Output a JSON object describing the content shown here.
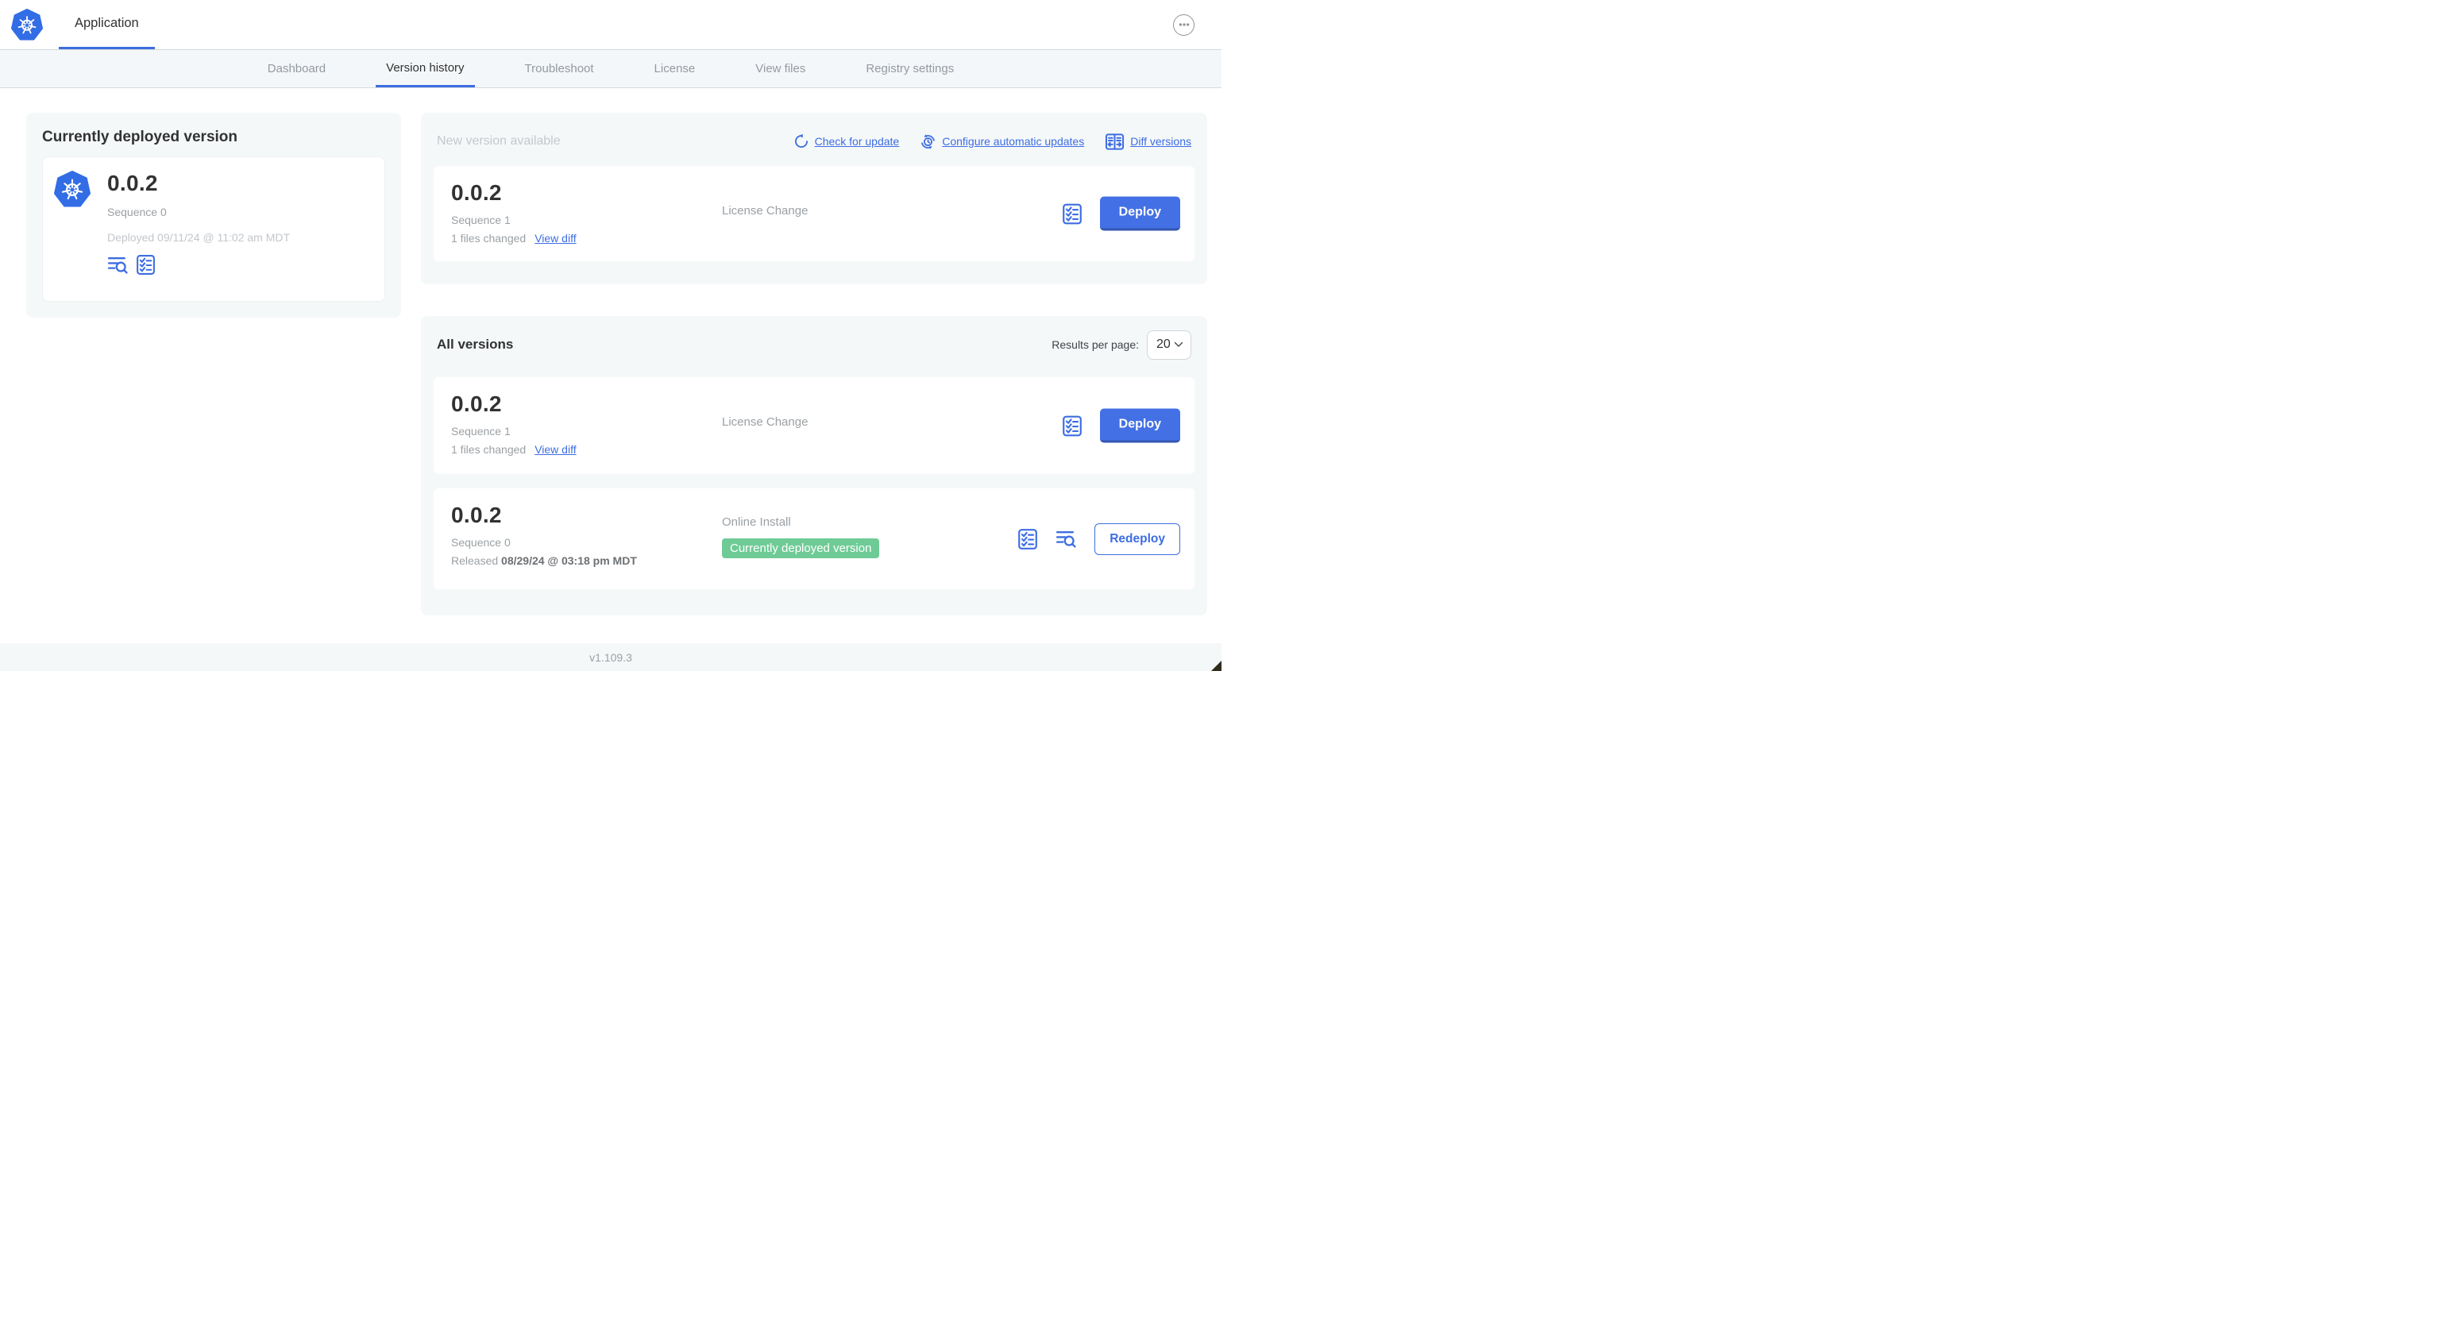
{
  "colors": {
    "accent_blue": "#3d6de2",
    "logo_blue": "#326de6",
    "deploy_button_blue": "#4370e4",
    "badge_green": "#6fcb96",
    "panel_gray": "#f5f8f9"
  },
  "header": {
    "app_tab": "Application"
  },
  "nav": {
    "tabs": [
      {
        "label": "Dashboard"
      },
      {
        "label": "Version history"
      },
      {
        "label": "Troubleshoot"
      },
      {
        "label": "License"
      },
      {
        "label": "View files"
      },
      {
        "label": "Registry settings"
      }
    ]
  },
  "current_version": {
    "title": "Currently deployed version",
    "version": "0.0.2",
    "sequence": "Sequence 0",
    "deployed": "Deployed 09/11/24 @ 11:02 am MDT"
  },
  "new_version": {
    "title": "New version available",
    "check_link": "Check for update",
    "configure_link": "Configure automatic updates",
    "diff_link": "Diff versions",
    "row": {
      "version": "0.0.2",
      "sequence": "Sequence 1",
      "files_changed": "1 files changed",
      "view_diff": "View diff",
      "source": "License Change",
      "action": "Deploy"
    }
  },
  "all_versions": {
    "title": "All versions",
    "results_label": "Results per page:",
    "results_value": "20",
    "rows": [
      {
        "version": "0.0.2",
        "sequence": "Sequence 1",
        "files_changed": "1 files changed",
        "view_diff": "View diff",
        "source": "License Change",
        "action": "Deploy"
      },
      {
        "version": "0.0.2",
        "sequence": "Sequence 0",
        "released_label": "Released",
        "released_date": "08/29/24 @ 03:18 pm MDT",
        "source": "Online Install",
        "badge": "Currently deployed version",
        "action": "Redeploy"
      }
    ]
  },
  "footer": {
    "app_version": "v1.109.3"
  }
}
